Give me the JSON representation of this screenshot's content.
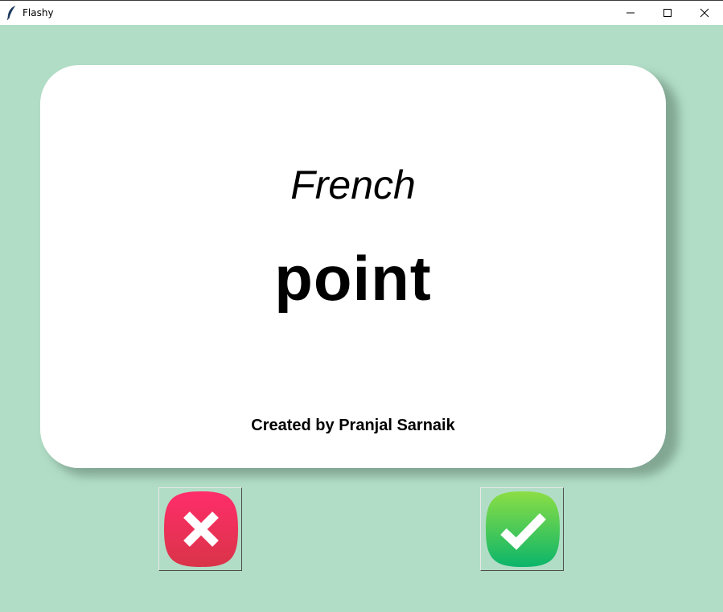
{
  "window": {
    "title": "Flashy",
    "icon": "feather-icon",
    "controls": [
      "minimize-icon",
      "maximize-icon",
      "close-icon"
    ]
  },
  "card": {
    "language": "French",
    "word": "point",
    "credit": "Created by Pranjal Sarnaik"
  },
  "buttons": {
    "wrong": {
      "icon": "cross-icon",
      "color": "#e8294f"
    },
    "right": {
      "icon": "check-icon",
      "color": "#22c55e"
    }
  },
  "colors": {
    "background": "#b1ddc6",
    "card": "#ffffff"
  }
}
